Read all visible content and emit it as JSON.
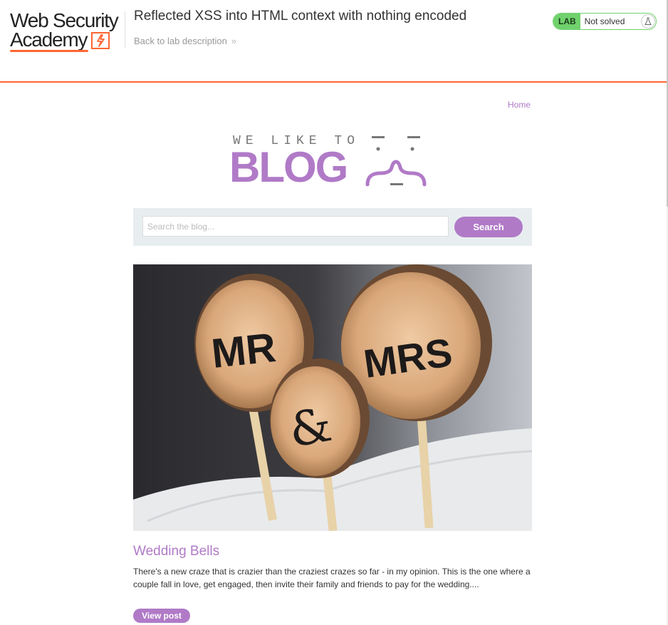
{
  "header": {
    "logo_line1": "Web Security",
    "logo_line2": "Academy",
    "lab_title": "Reflected XSS into HTML context with nothing encoded",
    "back_link": "Back to lab description",
    "lab_badge": "LAB",
    "lab_status": "Not solved",
    "colors": {
      "accent": "#ff6633",
      "solved_green": "#70d16d"
    }
  },
  "blog": {
    "home_link": "Home",
    "logo_small": "WE LIKE TO",
    "logo_big": "BLOG",
    "search_placeholder": "Search the blog...",
    "search_value": "",
    "search_button": "Search",
    "accent_color": "#b07ac7"
  },
  "post": {
    "image_subject": "wooden cake toppers reading MR & MRS",
    "title": "Wedding Bells",
    "summary": "There's a new craze that is crazier than the craziest crazes so far - in my opinion. This is the one where a couple fall in love, get engaged, then invite their family and friends to pay for the wedding....",
    "view_button": "View post"
  }
}
